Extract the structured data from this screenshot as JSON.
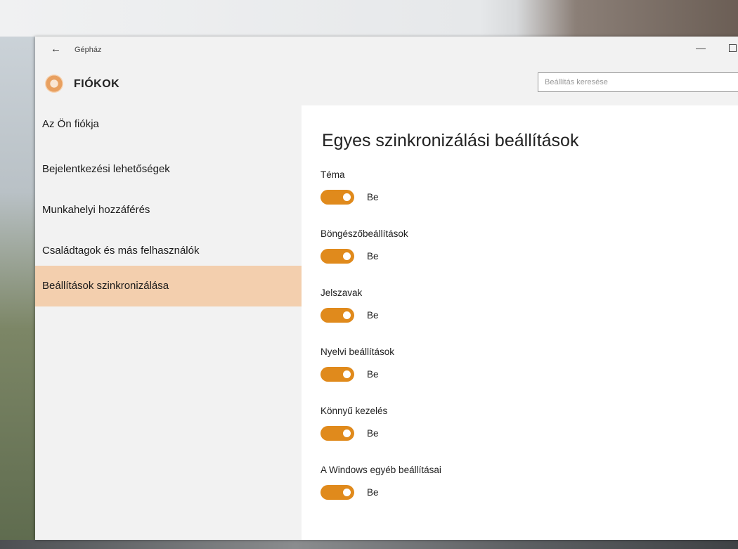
{
  "window": {
    "app_title": "Gépház",
    "back_icon": "back-arrow-icon",
    "minimize_glyph": "—"
  },
  "header": {
    "icon": "gear-icon",
    "title": "FIÓKOK",
    "search_placeholder": "Beállítás keresése"
  },
  "sidebar": {
    "items": [
      {
        "label": "Az Ön fiókja",
        "selected": false
      },
      {
        "label": "Bejelentkezési lehetőségek",
        "selected": false
      },
      {
        "label": "Munkahelyi hozzáférés",
        "selected": false
      },
      {
        "label": "Családtagok és más felhasználók",
        "selected": false
      },
      {
        "label": "Beállítások szinkronizálása",
        "selected": true
      }
    ],
    "selected_color": "#f3cfae"
  },
  "main": {
    "title": "Egyes szinkronizálási beállítások",
    "accent_color": "#e08a1c",
    "settings": [
      {
        "label": "Téma",
        "state": "Be",
        "on": true
      },
      {
        "label": "Böngészőbeállítások",
        "state": "Be",
        "on": true
      },
      {
        "label": "Jelszavak",
        "state": "Be",
        "on": true
      },
      {
        "label": "Nyelvi beállítások",
        "state": "Be",
        "on": true
      },
      {
        "label": "Könnyű kezelés",
        "state": "Be",
        "on": true
      },
      {
        "label": "A Windows egyéb beállításai",
        "state": "Be",
        "on": true
      }
    ]
  }
}
